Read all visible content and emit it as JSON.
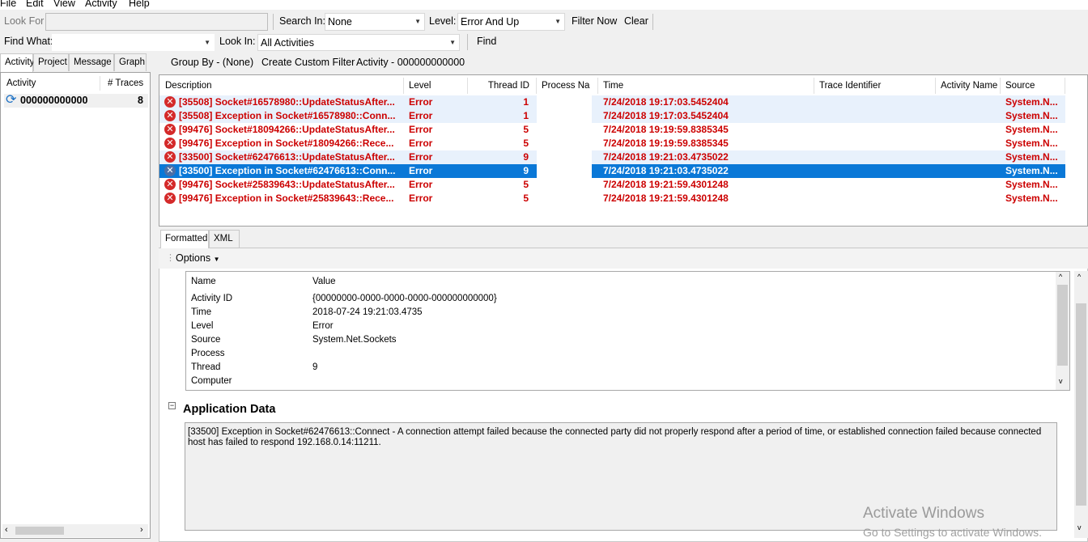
{
  "menu": [
    "File",
    "Edit",
    "View",
    "Activity",
    "Help"
  ],
  "toolbar1": {
    "look_for_label": "Look For",
    "look_for_value": "",
    "search_in_label": "Search In:",
    "search_in_value": "None",
    "level_label": "Level:",
    "level_value": "Error And Up",
    "filter_now": "Filter Now",
    "clear": "Clear"
  },
  "toolbar2": {
    "find_what_label": "Find What:",
    "find_what_value": "",
    "look_in_label": "Look In:",
    "look_in_value": "All Activities",
    "find": "Find"
  },
  "left_tabs": [
    "Activity",
    "Project",
    "Message",
    "Graph"
  ],
  "activity_list": {
    "col_activity": "Activity",
    "col_traces": "# Traces",
    "items": [
      {
        "name": "000000000000",
        "traces": "8"
      }
    ]
  },
  "groupbar": {
    "group_by": "Group By - (None)",
    "create_filter": "Create Custom Filter",
    "activity": "Activity - 000000000000"
  },
  "grid": {
    "columns": [
      "Description",
      "Level",
      "Thread ID",
      "Process Na",
      "Time",
      "Trace Identifier",
      "Activity Name",
      "Source"
    ],
    "rows": [
      {
        "desc": "[35508] Socket#16578980::UpdateStatusAfter...",
        "level": "Error",
        "thread": "1",
        "time": "7/24/2018 19:17:03.5452404",
        "source": "System.N..."
      },
      {
        "desc": "[35508] Exception in Socket#16578980::Conn...",
        "level": "Error",
        "thread": "1",
        "time": "7/24/2018 19:17:03.5452404",
        "source": "System.N..."
      },
      {
        "desc": "[99476] Socket#18094266::UpdateStatusAfter...",
        "level": "Error",
        "thread": "5",
        "time": "7/24/2018 19:19:59.8385345",
        "source": "System.N..."
      },
      {
        "desc": "[99476] Exception in Socket#18094266::Rece...",
        "level": "Error",
        "thread": "5",
        "time": "7/24/2018 19:19:59.8385345",
        "source": "System.N..."
      },
      {
        "desc": "[33500] Socket#62476613::UpdateStatusAfter...",
        "level": "Error",
        "thread": "9",
        "time": "7/24/2018 19:21:03.4735022",
        "source": "System.N..."
      },
      {
        "desc": "[33500] Exception in Socket#62476613::Conn...",
        "level": "Error",
        "thread": "9",
        "time": "7/24/2018 19:21:03.4735022",
        "source": "System.N..."
      },
      {
        "desc": "[99476] Socket#25839643::UpdateStatusAfter...",
        "level": "Error",
        "thread": "5",
        "time": "7/24/2018 19:21:59.4301248",
        "source": "System.N..."
      },
      {
        "desc": "[99476] Exception in Socket#25839643::Rece...",
        "level": "Error",
        "thread": "5",
        "time": "7/24/2018 19:21:59.4301248",
        "source": "System.N..."
      }
    ]
  },
  "bottom_tabs": [
    "Formatted",
    "XML"
  ],
  "options_label": "Options",
  "properties": {
    "name_header": "Name",
    "value_header": "Value",
    "items": [
      {
        "name": "Activity ID",
        "value": "{00000000-0000-0000-0000-000000000000}"
      },
      {
        "name": "Time",
        "value": "2018-07-24 19:21:03.4735"
      },
      {
        "name": "Level",
        "value": "Error"
      },
      {
        "name": "Source",
        "value": "System.Net.Sockets"
      },
      {
        "name": "Process",
        "value": ""
      },
      {
        "name": "Thread",
        "value": "9"
      },
      {
        "name": "Computer",
        "value": ""
      }
    ]
  },
  "app_data": {
    "title": "Application Data",
    "text": "[33500] Exception in Socket#62476613::Connect - A connection attempt failed because the connected party did not properly respond after a period of time, or established connection failed because connected host has failed to respond 192.168.0.14:11211."
  },
  "watermark": {
    "line1": "Activate Windows",
    "line2": "Go to Settings to activate Windows."
  },
  "colors": {
    "error_text": "#cc0000",
    "selection": "#0a78d7"
  }
}
